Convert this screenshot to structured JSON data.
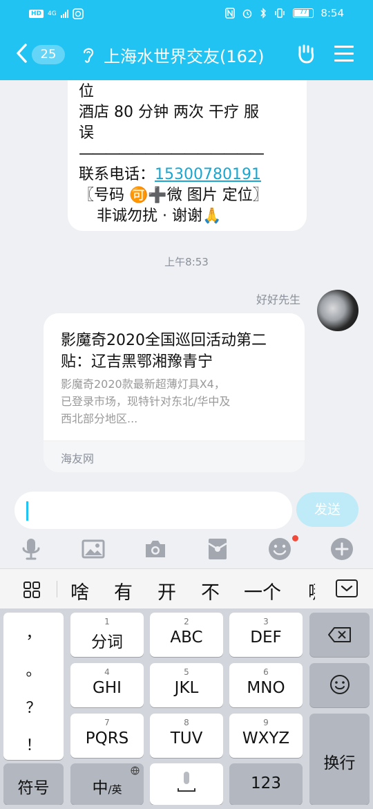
{
  "status_bar": {
    "network_badge": "HD",
    "network_type": "4G",
    "battery": "77",
    "time": "8:54"
  },
  "header": {
    "unread_count": "25",
    "title": "上海水世界交友(162)"
  },
  "previous_message": {
    "lines": [
      "位",
      "酒店 80 分钟 两次 干疗 服",
      "误",
      "——————————————"
    ],
    "phone_label": "联系电话：",
    "phone_number": "15300780191",
    "line_id_prefix": "〖号码 ",
    "line_id_emoji": "🉑",
    "line_id_suffix": "➕微 图片 定位〗",
    "closing_text": "非诚勿扰 · 谢谢",
    "closing_emoji": "🙏"
  },
  "timestamp": "上午8:53",
  "sender": {
    "name": "好好先生"
  },
  "link_card": {
    "title": "影魔奇2020全国巡回活动第二贴：辽吉黑鄂湘豫青宁",
    "description": "影魔奇2020款最新超薄灯具X4，已登录市场，现特针对东北/华中及西北部分地区...",
    "source": "海友网"
  },
  "input": {
    "send_label": "发送"
  },
  "toolbar": {
    "icons": [
      "microphone-icon",
      "image-icon",
      "camera-icon",
      "red-packet-icon",
      "emoji-icon",
      "plus-icon"
    ]
  },
  "ime": {
    "candidates": [
      "啥",
      "有",
      "开",
      "不",
      "一个",
      "哪"
    ]
  },
  "keyboard": {
    "punct": [
      "，",
      "。",
      "？",
      "！"
    ],
    "keys": [
      {
        "num": "1",
        "label": "分词"
      },
      {
        "num": "2",
        "label": "ABC"
      },
      {
        "num": "3",
        "label": "DEF"
      },
      {
        "num": "4",
        "label": "GHI"
      },
      {
        "num": "5",
        "label": "JKL"
      },
      {
        "num": "6",
        "label": "MNO"
      },
      {
        "num": "7",
        "label": "PQRS"
      },
      {
        "num": "8",
        "label": "TUV"
      },
      {
        "num": "9",
        "label": "WXYZ"
      }
    ],
    "enter_label": "换行",
    "symbol_label": "符号",
    "lang_main": "中",
    "lang_sub": "/英",
    "numeric_label": "123"
  },
  "colors": {
    "header_bg": "#21c3f2",
    "link": "#1aa6cf",
    "send_disabled": "#bfeaf8",
    "badge_dot": "#f24a3a"
  }
}
